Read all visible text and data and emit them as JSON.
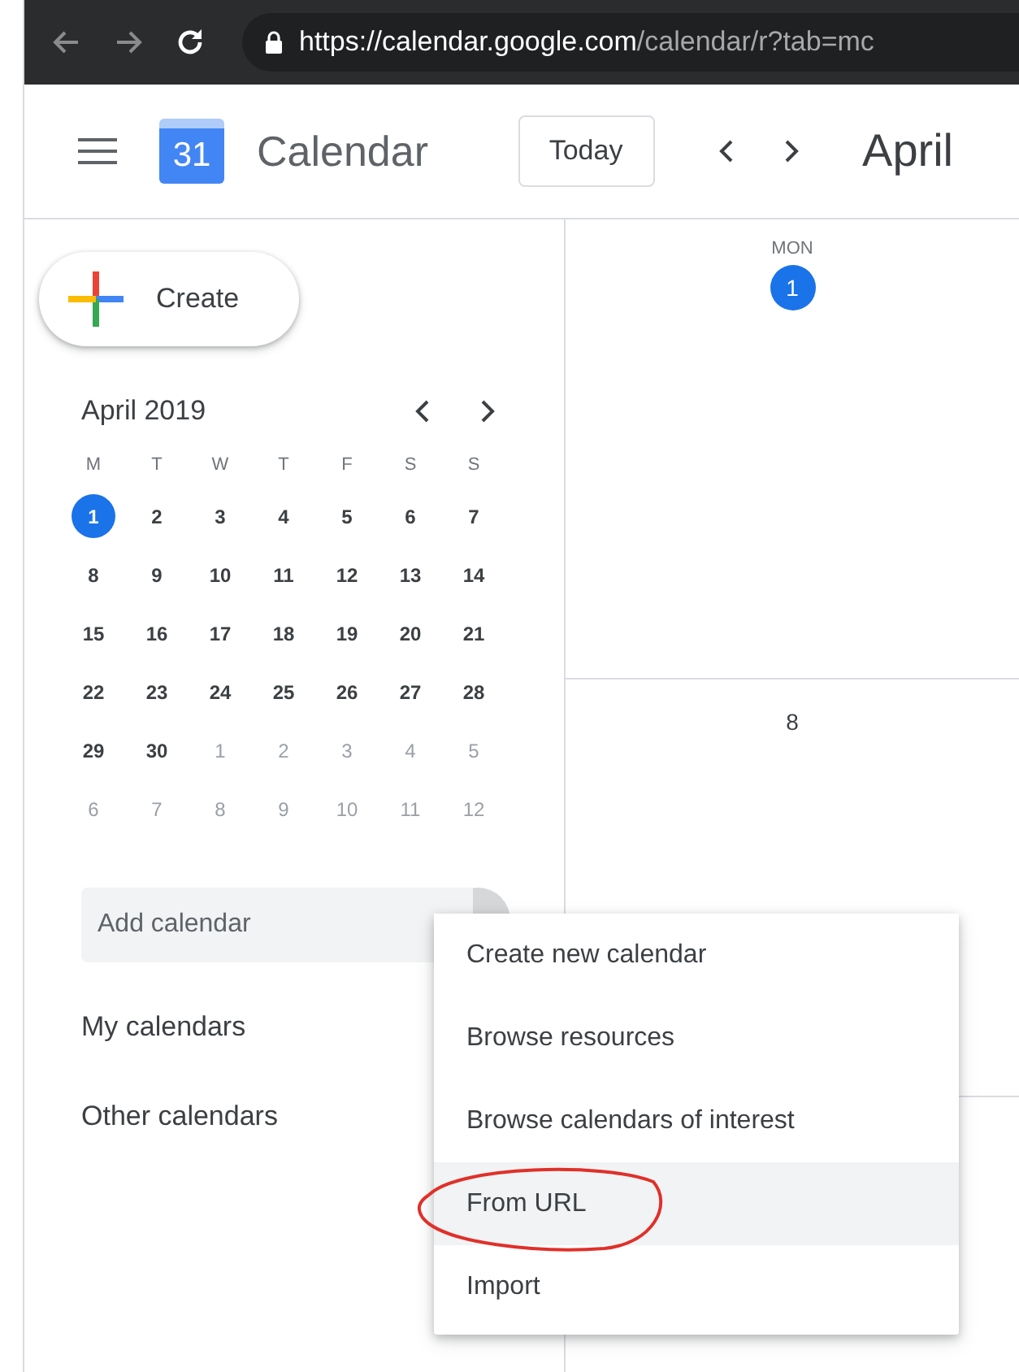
{
  "browser": {
    "url_host": "https://calendar.google.com",
    "url_path": "/calendar/r?tab=mc"
  },
  "header": {
    "logo_day": "31",
    "app_name": "Calendar",
    "today_button": "Today",
    "period": "April"
  },
  "create_button": "Create",
  "mini_calendar": {
    "title": "April 2019",
    "weekdays": [
      "M",
      "T",
      "W",
      "T",
      "F",
      "S",
      "S"
    ],
    "weeks": [
      [
        {
          "d": "1",
          "in_month": true,
          "selected": true
        },
        {
          "d": "2",
          "in_month": true,
          "selected": false
        },
        {
          "d": "3",
          "in_month": true,
          "selected": false
        },
        {
          "d": "4",
          "in_month": true,
          "selected": false
        },
        {
          "d": "5",
          "in_month": true,
          "selected": false
        },
        {
          "d": "6",
          "in_month": true,
          "selected": false
        },
        {
          "d": "7",
          "in_month": true,
          "selected": false
        }
      ],
      [
        {
          "d": "8",
          "in_month": true,
          "selected": false
        },
        {
          "d": "9",
          "in_month": true,
          "selected": false
        },
        {
          "d": "10",
          "in_month": true,
          "selected": false
        },
        {
          "d": "11",
          "in_month": true,
          "selected": false
        },
        {
          "d": "12",
          "in_month": true,
          "selected": false
        },
        {
          "d": "13",
          "in_month": true,
          "selected": false
        },
        {
          "d": "14",
          "in_month": true,
          "selected": false
        }
      ],
      [
        {
          "d": "15",
          "in_month": true,
          "selected": false
        },
        {
          "d": "16",
          "in_month": true,
          "selected": false
        },
        {
          "d": "17",
          "in_month": true,
          "selected": false
        },
        {
          "d": "18",
          "in_month": true,
          "selected": false
        },
        {
          "d": "19",
          "in_month": true,
          "selected": false
        },
        {
          "d": "20",
          "in_month": true,
          "selected": false
        },
        {
          "d": "21",
          "in_month": true,
          "selected": false
        }
      ],
      [
        {
          "d": "22",
          "in_month": true,
          "selected": false
        },
        {
          "d": "23",
          "in_month": true,
          "selected": false
        },
        {
          "d": "24",
          "in_month": true,
          "selected": false
        },
        {
          "d": "25",
          "in_month": true,
          "selected": false
        },
        {
          "d": "26",
          "in_month": true,
          "selected": false
        },
        {
          "d": "27",
          "in_month": true,
          "selected": false
        },
        {
          "d": "28",
          "in_month": true,
          "selected": false
        }
      ],
      [
        {
          "d": "29",
          "in_month": true,
          "selected": false
        },
        {
          "d": "30",
          "in_month": true,
          "selected": false
        },
        {
          "d": "1",
          "in_month": false,
          "selected": false
        },
        {
          "d": "2",
          "in_month": false,
          "selected": false
        },
        {
          "d": "3",
          "in_month": false,
          "selected": false
        },
        {
          "d": "4",
          "in_month": false,
          "selected": false
        },
        {
          "d": "5",
          "in_month": false,
          "selected": false
        }
      ],
      [
        {
          "d": "6",
          "in_month": false,
          "selected": false
        },
        {
          "d": "7",
          "in_month": false,
          "selected": false
        },
        {
          "d": "8",
          "in_month": false,
          "selected": false
        },
        {
          "d": "9",
          "in_month": false,
          "selected": false
        },
        {
          "d": "10",
          "in_month": false,
          "selected": false
        },
        {
          "d": "11",
          "in_month": false,
          "selected": false
        },
        {
          "d": "12",
          "in_month": false,
          "selected": false
        }
      ]
    ]
  },
  "add_calendar": {
    "placeholder": "Add calendar"
  },
  "sections": [
    "My calendars",
    "Other calendars"
  ],
  "week_cells": [
    {
      "weekday": "MON",
      "date": "1",
      "today": true
    },
    {
      "date": "8",
      "today": false
    }
  ],
  "menu": {
    "items": [
      {
        "label": "Create new calendar",
        "selected": false,
        "circled": false
      },
      {
        "label": "Browse resources",
        "selected": false,
        "circled": false
      },
      {
        "label": "Browse calendars of interest",
        "selected": false,
        "circled": false
      },
      {
        "label": "From URL",
        "selected": true,
        "circled": true
      },
      {
        "label": "Import",
        "selected": false,
        "circled": false
      }
    ]
  }
}
